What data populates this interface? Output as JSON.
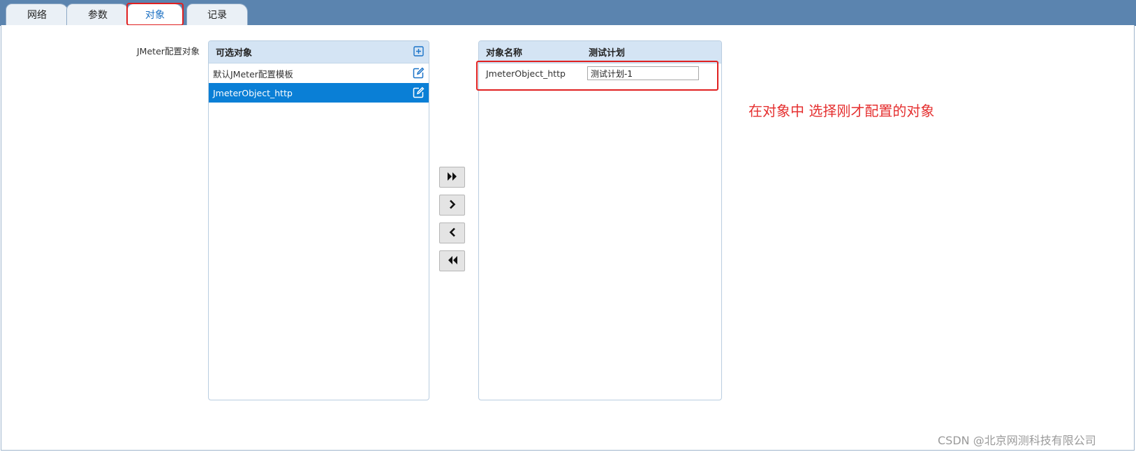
{
  "tabs": [
    {
      "label": "网络",
      "active": false
    },
    {
      "label": "参数",
      "active": false
    },
    {
      "label": "对象",
      "active": true
    },
    {
      "label": "记录",
      "active": false
    }
  ],
  "field_label": "JMeter配置对象",
  "available_panel": {
    "title": "可选对象",
    "add_icon": "plus-square-icon",
    "items": [
      {
        "label": "默认JMeter配置模板",
        "selected": false,
        "icon": "edit-icon"
      },
      {
        "label": "JmeterObject_http",
        "selected": true,
        "icon": "edit-icon"
      }
    ]
  },
  "transfer_buttons": [
    {
      "name": "move-all-right",
      "icon": "double-chevron-right-icon"
    },
    {
      "name": "move-right",
      "icon": "chevron-right-icon"
    },
    {
      "name": "move-left",
      "icon": "chevron-left-icon"
    },
    {
      "name": "move-all-left",
      "icon": "double-chevron-left-icon"
    }
  ],
  "selected_panel": {
    "col_name": "对象名称",
    "col_plan": "测试计划",
    "rows": [
      {
        "name": "JmeterObject_http",
        "plan": "测试计划-1"
      }
    ]
  },
  "annotation": "在对象中 选择刚才配置的对象",
  "watermark": "CSDN @北京网测科技有限公司",
  "colors": {
    "topbar": "#5b84af",
    "selected_row": "#0a7fd6",
    "panel_header": "#d4e4f4",
    "highlight": "#e02020",
    "annotation": "#e53030",
    "icon_blue": "#1a73c8"
  }
}
